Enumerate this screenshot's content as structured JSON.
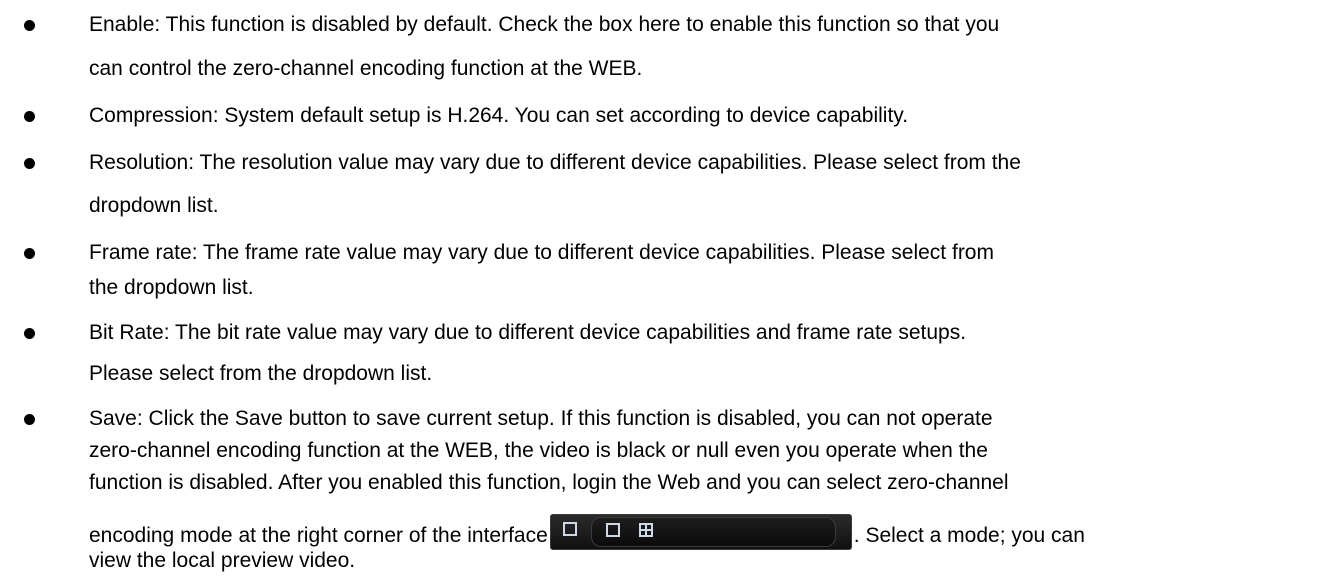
{
  "bullets": [
    {
      "lines": [
        "Enable: This function is disabled by default. Check the box here to enable this function so that you",
        "can control the zero-channel encoding function at the WEB."
      ]
    },
    {
      "lines": [
        "Compression: System default setup is H.264. You can set according to device capability."
      ]
    },
    {
      "lines": [
        "Resolution: The resolution value may vary due to different device capabilities. Please select from the",
        "dropdown list."
      ]
    },
    {
      "lines": [
        "Frame rate: The frame rate value may vary due to different device capabilities. Please select from",
        "the dropdown list."
      ]
    },
    {
      "lines": [
        "Bit Rate: The bit rate value may vary due to different device capabilities and frame rate setups.",
        "Please select from the dropdown list."
      ]
    },
    {
      "lines": [
        "Save: Click the Save button to save current setup. If this function is disabled, you can not operate",
        "zero-channel encoding function at the WEB, the video is black or null even you operate when the",
        "function is disabled. After you enabled this function, login the Web and you can select zero-channel"
      ],
      "inline_line": {
        "before": "encoding mode at the right corner of the interface",
        "after": ". Select a mode; you can"
      },
      "last_line": "view the local preview video."
    }
  ],
  "inline_toolbar": {
    "icons": [
      "single-window-icon",
      "single-window-icon",
      "four-window-grid-icon"
    ],
    "background": "#1a1a1a",
    "icon_color": "#cfd8e6"
  }
}
